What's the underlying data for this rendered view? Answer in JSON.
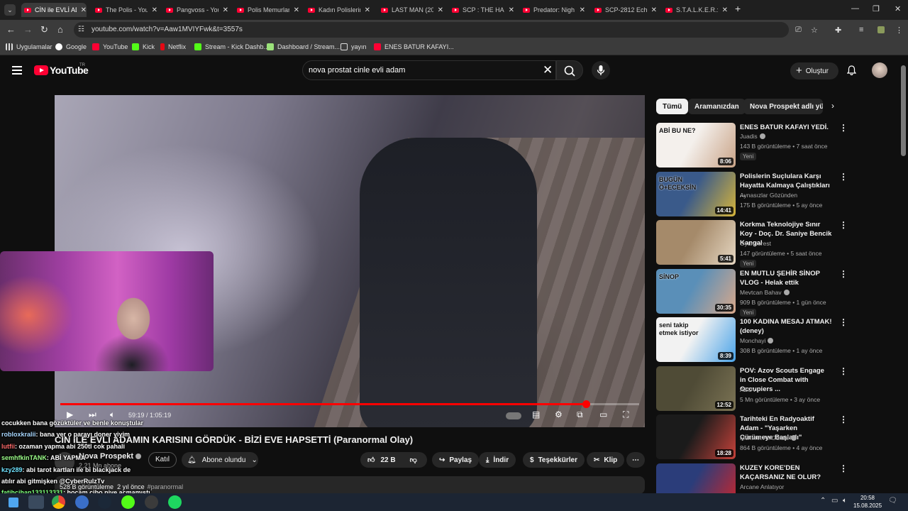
{
  "browser": {
    "tabs": [
      {
        "title": "CİN ile EVLİ ADAM",
        "active": true
      },
      {
        "title": "The Polis - YouTube"
      },
      {
        "title": "Pangvoss - YouTube"
      },
      {
        "title": "Polis Memurları"
      },
      {
        "title": "Kadın Polislerin"
      },
      {
        "title": "LAST MAN (20"
      },
      {
        "title": "SCP : THE HAL"
      },
      {
        "title": "Predator: Nigh"
      },
      {
        "title": "SCP-2812 Eche"
      },
      {
        "title": "S.T.A.L.K.E.R.: S"
      }
    ],
    "tab_close": "✕",
    "new_tab": "+",
    "url": "youtube.com/watch?v=Aaw1MVIYFwk&t=3557s",
    "bookmarks": [
      "Uygulamalar",
      "Google",
      "YouTube",
      "Kick",
      "Netflix",
      "Stream - Kick Dashb...",
      "Dashboard / Stream...",
      "yayın",
      "ENES BATUR KAFAYI..."
    ]
  },
  "youtube": {
    "logo_text": "YouTube",
    "region": "TR",
    "search_value": "nova prostat cinle evli adam",
    "create_label": "Oluştur"
  },
  "player": {
    "time_current": "59:19",
    "time_total": "1:05:19",
    "progress_fraction": 0.908
  },
  "video": {
    "title": "CİN İLE EVLİ ADAMIN KARISINI GÖRDÜK - BİZİ EVE HAPSETTİ (Paranormal Olay)",
    "channel": "Nova Prospekt",
    "subscribers": "2,21 Mn abone",
    "join_label": "Katıl",
    "subscribed_label": "Abone olundu",
    "likes": "22 B",
    "share_label": "Paylaş",
    "download_label": "İndir",
    "thanks_label": "Teşekkürler",
    "clip_label": "Klip",
    "views": "528 B görüntüleme",
    "age": "2 yıl önce",
    "hashtag": "#paranormal"
  },
  "chat": [
    {
      "user": "",
      "text": "cocukken bana gözüktüler ve benle konuştular",
      "color": "#ffffff"
    },
    {
      "user": "robloxkralii",
      "text": ": bana yer o parayı doner yiyim",
      "color": "#a9d8ff"
    },
    {
      "user": "lutfii",
      "text": ": ozaman yapma abi 250tl cok pahali",
      "color": "#ff6b6b"
    },
    {
      "user": "semhfkinTANK",
      "text": ": ABİ YAPMA",
      "color": "#9dff8a"
    },
    {
      "user": "kzy289",
      "text": ": abi tarot kartları ile bi blackjack de",
      "color": "#6fe3ff"
    },
    {
      "user": "",
      "text": "atılır abi gitmişken @CyberRulzTv",
      "color": "#ffffff"
    },
    {
      "user": "fatihcihan133113331",
      "text": ": hocam cibo niye açmamıştı",
      "color": "#7dff7d"
    },
    {
      "user": "",
      "text": "biliyon mu",
      "color": "#ffffff"
    }
  ],
  "sidebar": {
    "chips": [
      "Tümü",
      "Aramanızdan",
      "Nova Prospekt adlı yükle"
    ],
    "recs": [
      {
        "title": "ENES BATUR KAFAYI YEDİ.",
        "channel": "Juadis",
        "verified": true,
        "meta": "143 B görüntüleme • 7 saat önce",
        "badge": "Yeni",
        "duration": "8:06",
        "thumb_text": "ABİ BU NE?",
        "c1": "#f4f0ec",
        "c2": "#c9a387"
      },
      {
        "title": "Polislerin Suçlulara Karşı Hayatta Kalmaya Çalıştıkları ...",
        "channel": "Aynasızlar Gözünden",
        "verified": false,
        "meta": "175 B görüntüleme • 5 ay önce",
        "badge": "",
        "duration": "14:41",
        "thumb_text": "BUGÜN Ö+ECEKSİN",
        "c1": "#3a5a8a",
        "c2": "#d6b43a"
      },
      {
        "title": "Korkma Teknolojiye Sınır Koy - Doç. Dr. Saniye Bencik Kangal",
        "channel": "Oyunperest",
        "verified": false,
        "meta": "147 görüntüleme • 5 saat önce",
        "badge": "Yeni",
        "duration": "5:41",
        "thumb_text": "",
        "c1": "#a58a6a",
        "c2": "#e6d7c2"
      },
      {
        "title": "EN MUTLU ŞEHİR SİNOP VLOG - Helak ettik",
        "channel": "Mevtcan Bahav",
        "verified": true,
        "meta": "909 B görüntüleme • 1 gün önce",
        "badge": "Yeni",
        "duration": "30:35",
        "thumb_text": "SİNOP",
        "c1": "#5a8fb8",
        "c2": "#d9a88a"
      },
      {
        "title": "100 KADINA MESAJ ATMAK! (deney)",
        "channel": "Monchayi",
        "verified": true,
        "meta": "308 B görüntüleme • 1 ay önce",
        "badge": "",
        "duration": "8:39",
        "thumb_text": "seni takip etmek istiyor",
        "c1": "#f2f2f2",
        "c2": "#4aa3e8"
      },
      {
        "title": "POV: Azov Scouts Engage in Close Combat with Occupiers ...",
        "channel": "AZOV",
        "verified": false,
        "meta": "5 Mn görüntüleme • 3 ay önce",
        "badge": "",
        "duration": "12:52",
        "thumb_text": "",
        "c1": "#4f4b36",
        "c2": "#7b7354"
      },
      {
        "title": "Tarihteki En Radyoaktif Adam - \"Yaşarken Çürümeye Başladı\"",
        "channel": "Mehmet Ali Güldal",
        "verified": true,
        "meta": "864 B görüntüleme • 4 ay önce",
        "badge": "",
        "duration": "18:28",
        "thumb_text": "",
        "c1": "#1b1b1b",
        "c2": "#c6423a"
      },
      {
        "title": "KUZEY KORE'DEN KAÇARSANIZ NE OLUR?",
        "channel": "Arcane Anlatıyor",
        "verified": false,
        "meta": "",
        "badge": "",
        "duration": "",
        "thumb_text": "",
        "c1": "#2b3d7a",
        "c2": "#c9262c"
      }
    ]
  },
  "taskbar": {
    "time": "20:58",
    "date": "15.08.2025"
  }
}
